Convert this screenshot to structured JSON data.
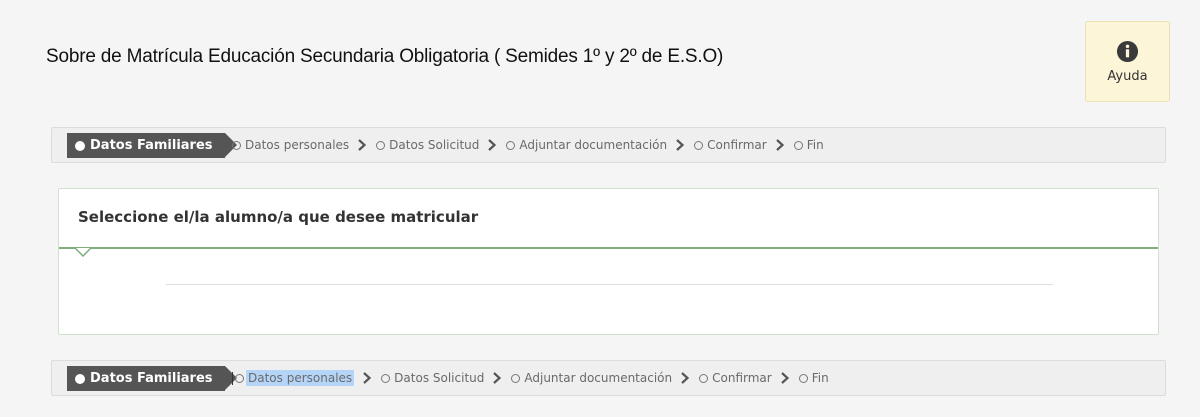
{
  "header": {
    "title": "Sobre de Matrícula Educación Secundaria Obligatoria ( Semides 1º y 2º de E.S.O)",
    "help": {
      "label": "Ayuda",
      "icon": "info-icon"
    }
  },
  "stepper_top": {
    "active": "Datos Familiares",
    "steps": [
      "Datos personales",
      "Datos Solicitud",
      "Adjuntar documentación",
      "Confirmar",
      "Fin"
    ]
  },
  "card": {
    "title": "Seleccione el/la alumno/a que desee matricular"
  },
  "stepper_bottom": {
    "active": "Datos Familiares",
    "steps": [
      "Datos personales",
      "Datos Solicitud",
      "Adjuntar documentación",
      "Confirmar",
      "Fin"
    ],
    "selected_step": "Datos personales"
  },
  "colors": {
    "active_step_bg": "#555555",
    "help_bg": "#fcf5d8",
    "card_accent": "#7cb07d",
    "selection": "#b5d5f8"
  }
}
